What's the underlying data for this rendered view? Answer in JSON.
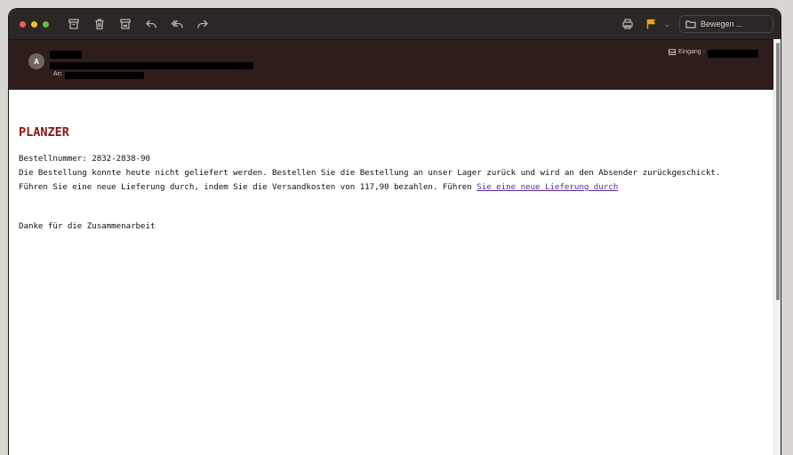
{
  "toolbar": {
    "icons": [
      "archive-icon",
      "trash-icon",
      "junk-icon",
      "reply-icon",
      "reply-all-icon",
      "forward-icon"
    ],
    "move_label": "Bewegen ..."
  },
  "header": {
    "avatar_initial": "A",
    "to_label": "An:",
    "mailbox_label": "Eingang - "
  },
  "message": {
    "brand": "PLANZER",
    "order_line": "Bestellnummer: 2832-2838-90",
    "line2": "Die Bestellung konnte heute nicht geliefert werden. Bestellen Sie die Bestellung an unser Lager zurück und wird an den Absender zurückgeschickt.",
    "line3_text": "Führen Sie eine neue Lieferung durch, indem Sie die Versandkosten von 117,90 bezahlen. Führen ",
    "line3_link": "Sie eine neue Lieferung durch",
    "closing": "Danke für die Zusammenarbeit"
  },
  "colors": {
    "brand": "#8c1414",
    "link": "#5b2aa4",
    "flag": "#f5a300"
  }
}
